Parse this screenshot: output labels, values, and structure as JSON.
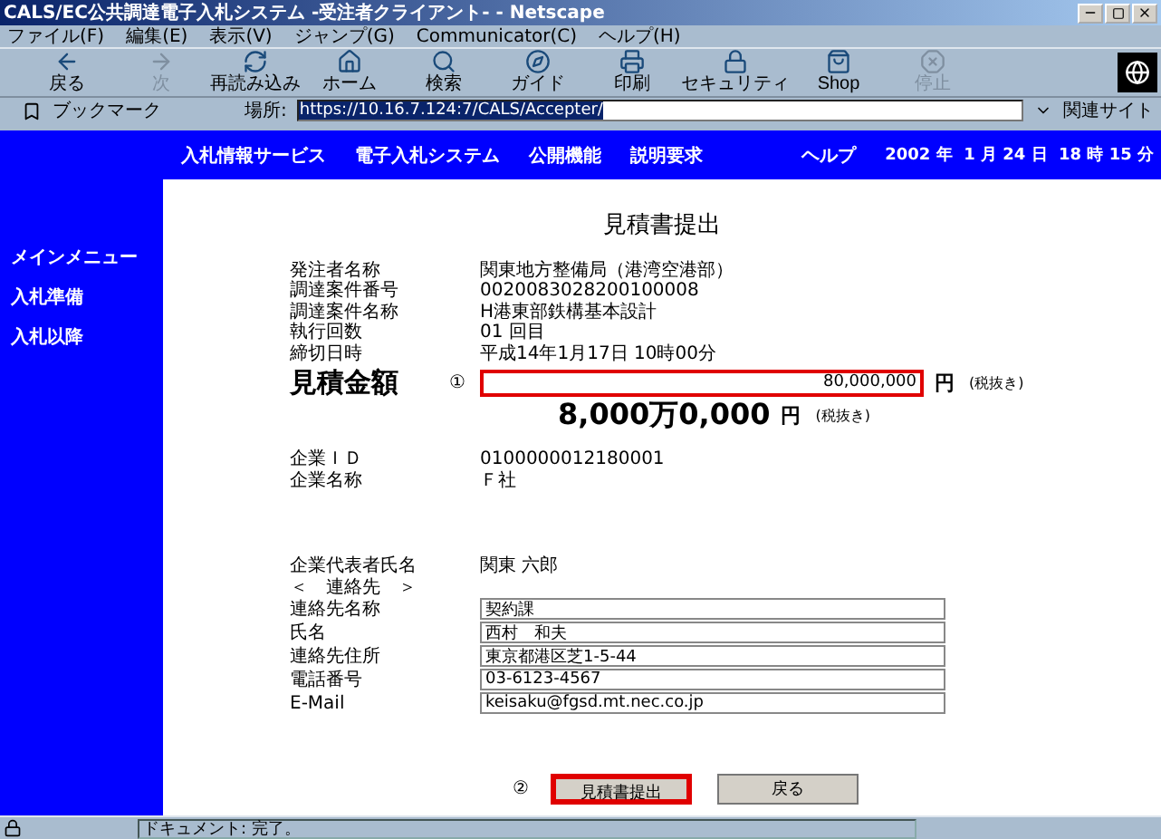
{
  "window": {
    "title": "CALS/EC公共調達電子入札システム -受注者クライアント- - Netscape"
  },
  "menu": [
    "ファイル(F)",
    "編集(E)",
    "表示(V)",
    "ジャンプ(G)",
    "Communicator(C)",
    "ヘルプ(H)"
  ],
  "toolbar": [
    {
      "label": "戻る",
      "disabled": false
    },
    {
      "label": "次",
      "disabled": true
    },
    {
      "label": "再読み込み",
      "disabled": false
    },
    {
      "label": "ホーム",
      "disabled": false
    },
    {
      "label": "検索",
      "disabled": false
    },
    {
      "label": "ガイド",
      "disabled": false
    },
    {
      "label": "印刷",
      "disabled": false
    },
    {
      "label": "セキュリティ",
      "disabled": false
    },
    {
      "label": "Shop",
      "disabled": false
    },
    {
      "label": "停止",
      "disabled": true
    }
  ],
  "location": {
    "bookmarks": "ブックマーク",
    "label": "場所:",
    "url": "https://10.16.7.124:7/CALS/Accepter/",
    "related": "関連サイト"
  },
  "header": {
    "nav": [
      "入札情報サービス",
      "電子入札システム",
      "公開機能",
      "説明要求"
    ],
    "help": "ヘルプ",
    "date": "2002 年  1 月 24 日  18 時 15 分"
  },
  "sidebar": [
    "メインメニュー",
    "入札準備",
    "入札以降"
  ],
  "page_title": "見積書提出",
  "info": [
    {
      "label": "発注者名称",
      "value": "関東地方整備局（港湾空港部）"
    },
    {
      "label": "調達案件番号",
      "value": "0020083028200100008"
    },
    {
      "label": "調達案件名称",
      "value": "H港東部鉄構基本設計"
    },
    {
      "label": "執行回数",
      "value": "01 回目"
    },
    {
      "label": "締切日時",
      "value": "平成14年1月17日 10時00分"
    }
  ],
  "amount": {
    "label": "見積金額",
    "marker": "①",
    "value": "80,000,000",
    "unit": "円",
    "note": "(税抜き)",
    "formatted": "8,000万0,000",
    "formatted_unit": "円",
    "formatted_note": "(税抜き)"
  },
  "company": [
    {
      "label": "企業ＩＤ",
      "value": "0100000012180001"
    },
    {
      "label": "企業名称",
      "value": "Ｆ社"
    }
  ],
  "representative": {
    "label": "企業代表者氏名",
    "value": "関東 六郎"
  },
  "contact_heading": "＜　連絡先　＞",
  "contact": [
    {
      "label": "連絡先名称",
      "value": "契約課"
    },
    {
      "label": "氏名",
      "value": "西村　和夫"
    },
    {
      "label": "連絡先住所",
      "value": "東京都港区芝1-5-44"
    },
    {
      "label": "電話番号",
      "value": "03-6123-4567"
    },
    {
      "label": "E-Mail",
      "value": "keisaku@fgsd.mt.nec.co.jp"
    }
  ],
  "actions": {
    "marker": "②",
    "buttons": [
      {
        "label": "見積書提出",
        "highlighted": true
      },
      {
        "label": "戻る",
        "highlighted": false
      }
    ]
  },
  "status_bar": {
    "text": "ドキュメント: 完了。"
  }
}
